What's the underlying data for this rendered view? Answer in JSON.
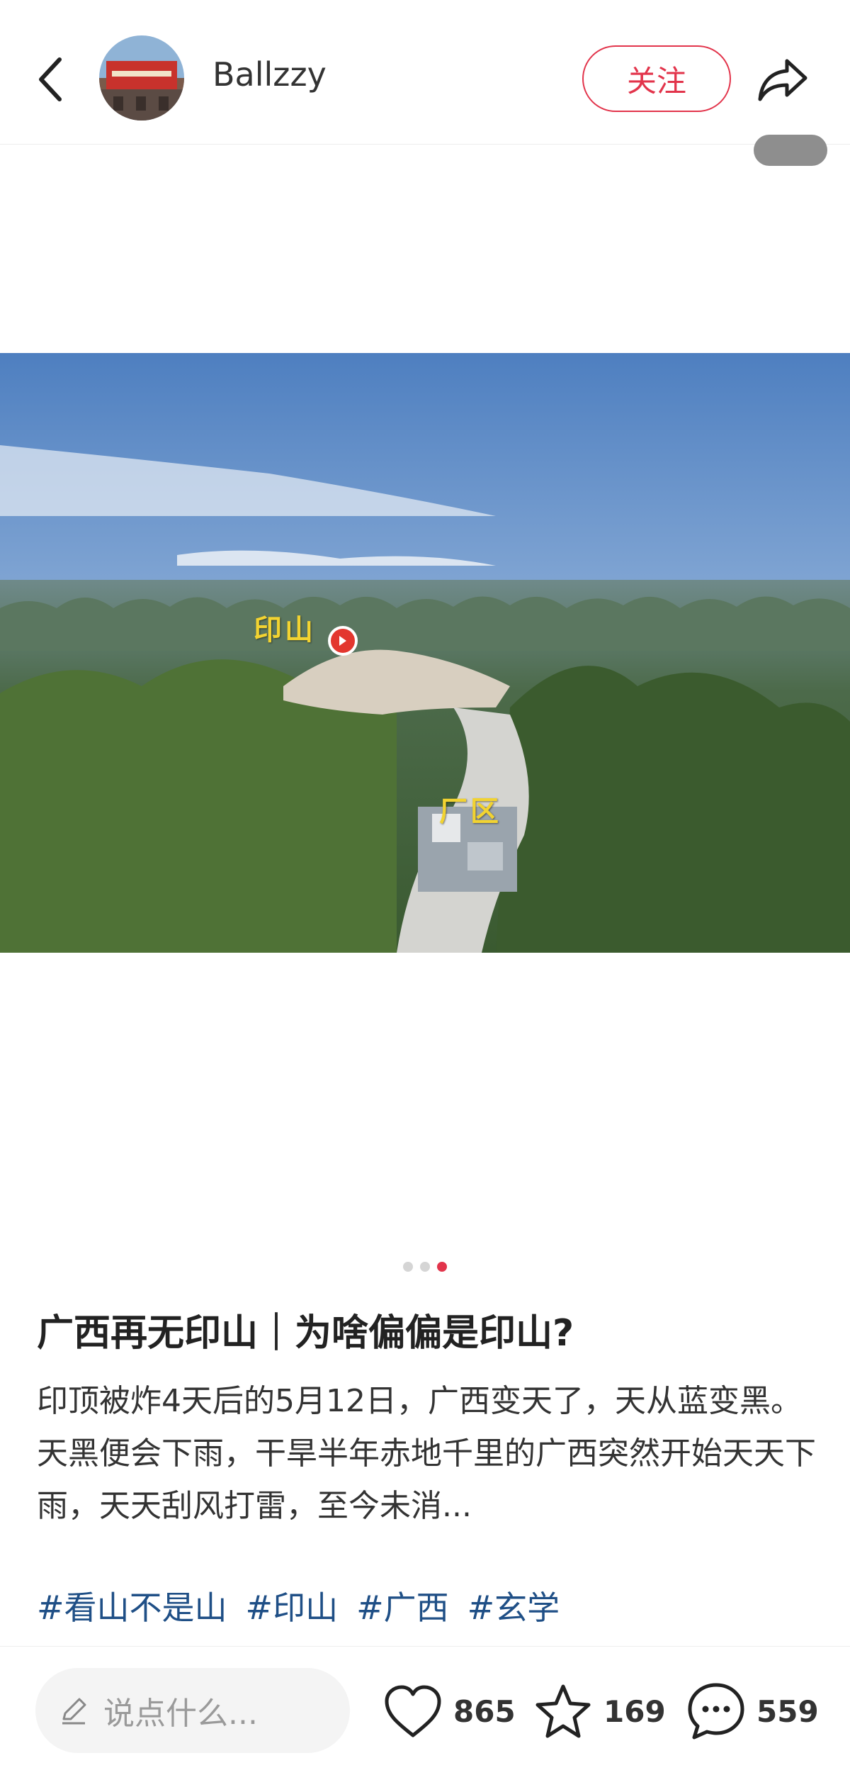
{
  "header": {
    "username": "Ballzzy",
    "follow_label": "关注",
    "icons": {
      "back": "chevron-left-icon",
      "share": "share-arrow-icon"
    }
  },
  "image": {
    "label_yinshan": "印山",
    "label_changqu": "厂区",
    "current_page": 3,
    "total_pages": 3
  },
  "post": {
    "title": "广西再无印山｜为啥偏偏是印山?",
    "body_line1": "印顶被炸4天后的5月12日，广西变天了，天从蓝变黑。",
    "body_line2": "天黑便会下雨，干旱半年赤地千里的广西突然开始天天下雨，天天刮风打雷，至今未消...",
    "tags": [
      "#看山不是山",
      "#印山",
      "#广西",
      "#玄学"
    ]
  },
  "bottom_bar": {
    "comment_placeholder": "说点什么...",
    "likes": "865",
    "collects": "169",
    "comments": "559"
  },
  "colors": {
    "accent": "#e2344b",
    "tag": "#1f4f86",
    "label_yellow": "#f2d331"
  }
}
